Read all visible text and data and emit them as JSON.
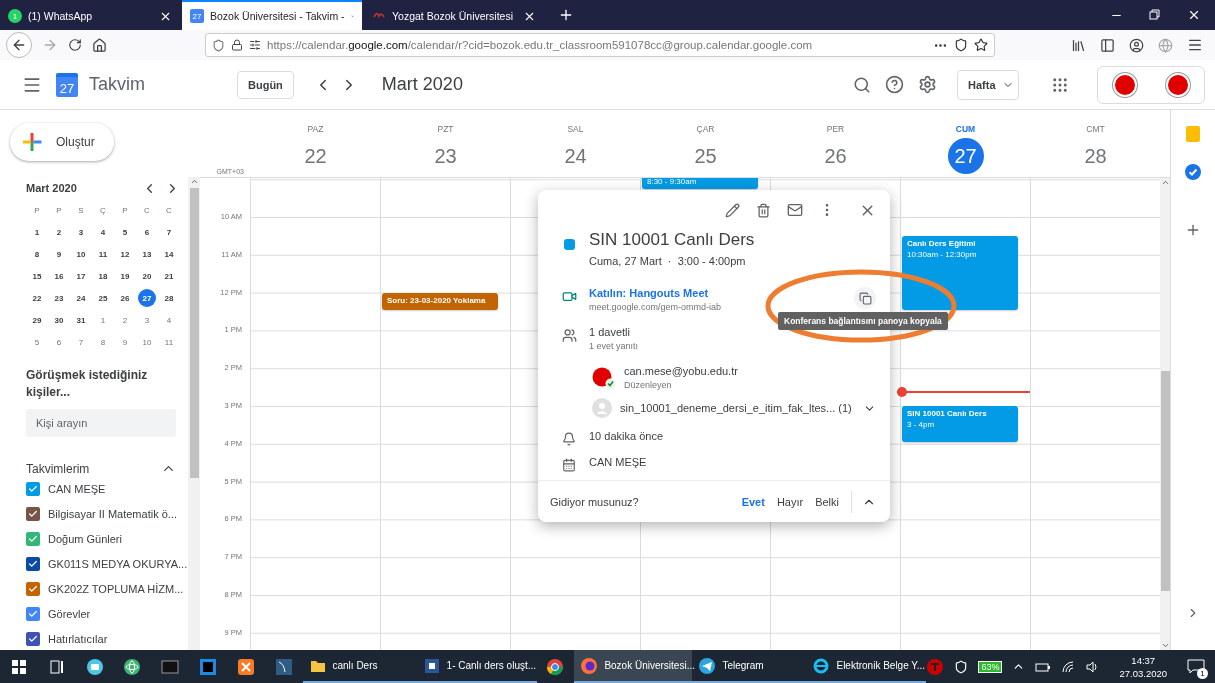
{
  "browser": {
    "tabs": [
      {
        "label": "(1) WhatsApp",
        "badge": "1",
        "selected": false
      },
      {
        "label": "Bozok Üniversitesi - Takvim -",
        "badge": "27",
        "selected": true
      },
      {
        "label": "Yozgat Bozok Üniversitesi",
        "selected": false
      }
    ],
    "url": "https://calendar.**google.com**/calendar/r?cid=bozok.edu.tr_classroom591078cc@group.calendar.google.com"
  },
  "header": {
    "logo_day": "27",
    "app_title": "Takvim",
    "today_button": "Bugün",
    "period": "Mart 2020",
    "view": "Hafta"
  },
  "sidebar": {
    "create_button": "Oluştur",
    "mini_calendar": {
      "title": "Mart 2020",
      "weekdays": [
        "P",
        "P",
        "S",
        "Ç",
        "P",
        "C",
        "C"
      ],
      "weeks": [
        [
          {
            "d": "1",
            "out": false,
            "selected": false
          },
          {
            "d": "2",
            "out": false,
            "selected": false
          },
          {
            "d": "3",
            "out": false,
            "selected": false
          },
          {
            "d": "4",
            "out": false,
            "selected": false
          },
          {
            "d": "5",
            "out": false,
            "selected": false
          },
          {
            "d": "6",
            "out": false,
            "selected": false
          },
          {
            "d": "7",
            "out": false,
            "selected": false
          }
        ],
        [
          {
            "d": "8",
            "out": false,
            "selected": false
          },
          {
            "d": "9",
            "out": false,
            "selected": false
          },
          {
            "d": "10",
            "out": false,
            "selected": false
          },
          {
            "d": "11",
            "out": false,
            "selected": false
          },
          {
            "d": "12",
            "out": false,
            "selected": false
          },
          {
            "d": "13",
            "out": false,
            "selected": false
          },
          {
            "d": "14",
            "out": false,
            "selected": false
          }
        ],
        [
          {
            "d": "15",
            "out": false,
            "selected": false
          },
          {
            "d": "16",
            "out": false,
            "selected": false
          },
          {
            "d": "17",
            "out": false,
            "selected": false
          },
          {
            "d": "18",
            "out": false,
            "selected": false
          },
          {
            "d": "19",
            "out": false,
            "selected": false
          },
          {
            "d": "20",
            "out": false,
            "selected": false
          },
          {
            "d": "21",
            "out": false,
            "selected": false
          }
        ],
        [
          {
            "d": "22",
            "out": false,
            "selected": false
          },
          {
            "d": "23",
            "out": false,
            "selected": false
          },
          {
            "d": "24",
            "out": false,
            "selected": false
          },
          {
            "d": "25",
            "out": false,
            "selected": false
          },
          {
            "d": "26",
            "out": false,
            "selected": false
          },
          {
            "d": "27",
            "out": false,
            "selected": true
          },
          {
            "d": "28",
            "out": false,
            "selected": false
          }
        ],
        [
          {
            "d": "29",
            "out": false,
            "selected": false
          },
          {
            "d": "30",
            "out": false,
            "selected": false
          },
          {
            "d": "31",
            "out": false,
            "selected": false
          },
          {
            "d": "1",
            "out": true,
            "selected": false
          },
          {
            "d": "2",
            "out": true,
            "selected": false
          },
          {
            "d": "3",
            "out": true,
            "selected": false
          },
          {
            "d": "4",
            "out": true,
            "selected": false
          }
        ],
        [
          {
            "d": "5",
            "out": true,
            "selected": false
          },
          {
            "d": "6",
            "out": true,
            "selected": false
          },
          {
            "d": "7",
            "out": true,
            "selected": false
          },
          {
            "d": "8",
            "out": true,
            "selected": false
          },
          {
            "d": "9",
            "out": true,
            "selected": false
          },
          {
            "d": "10",
            "out": true,
            "selected": false
          },
          {
            "d": "11",
            "out": true,
            "selected": false
          }
        ]
      ]
    },
    "people_title": "Görüşmek istediğiniz kişiler...",
    "people_search": {
      "placeholder": "Kişi arayın"
    },
    "calendars_title": "Takvimlerim",
    "calendars": [
      {
        "label": "CAN MEŞE",
        "color": "#039be5",
        "checked": true
      },
      {
        "label": "Bilgisayar II Matematik ö...",
        "color": "#795548",
        "checked": true
      },
      {
        "label": "Doğum Günleri",
        "color": "#33b679",
        "checked": true
      },
      {
        "label": "GK011S MEDYA OKURYA...",
        "color": "#0b4aa8",
        "checked": true
      },
      {
        "label": "GK202Z TOPLUMA HİZM...",
        "color": "#c26401",
        "checked": true
      },
      {
        "label": "Görevler",
        "color": "#4285f4",
        "checked": true
      },
      {
        "label": "Hatırlatıcılar",
        "color": "#3f51b5",
        "checked": true
      }
    ]
  },
  "week": {
    "timezone": "GMT+03",
    "days": [
      {
        "dow": "PAZ",
        "date": "22",
        "today": false,
        "now_line": false
      },
      {
        "dow": "PZT",
        "date": "23",
        "today": false,
        "now_line": false,
        "events": [
          {
            "title": "Soru: 23-03-2020 Yoklama",
            "color": "#c26401"
          }
        ]
      },
      {
        "dow": "SAL",
        "date": "24",
        "today": false,
        "now_line": false
      },
      {
        "dow": "ÇAR",
        "date": "25",
        "today": false,
        "now_line": false,
        "events": [
          {
            "time": "8:30 - 9:30am",
            "color": "#039be5"
          }
        ]
      },
      {
        "dow": "PER",
        "date": "26",
        "today": false,
        "now_line": false
      },
      {
        "dow": "CUM",
        "date": "27",
        "today": true,
        "now_line": true,
        "events": [
          {
            "title": "Canlı Ders Eğitimi",
            "time": "10:30am - 12:30pm",
            "color": "#039be5"
          },
          {
            "title": "SIN 10001 Canlı Ders",
            "time": "3 - 4pm",
            "color": "#039be5"
          }
        ]
      },
      {
        "dow": "CMT",
        "date": "28",
        "today": false,
        "now_line": false
      }
    ],
    "hours": [
      "10 AM",
      "11 AM",
      "12 PM",
      "1 PM",
      "2 PM",
      "3 PM",
      "4 PM",
      "5 PM",
      "6 PM",
      "7 PM",
      "8 PM",
      "9 PM"
    ]
  },
  "popup": {
    "color": "#039be5",
    "title": "SIN 10001 Canlı Ders",
    "when": "Cuma, 27 Mart  ·  3:00 - 4:00pm",
    "meet_link": "Katılın: Hangouts Meet",
    "meet_url": "meet.google.com/gem-ommd-iab",
    "copy_tooltip": "Konferans bağlantısını panoya kopyala",
    "guests_count": "1 davetli",
    "guests_summary": "1 evet yanıtı",
    "guests": [
      {
        "kind": "organizer",
        "name": "can.mese@yobu.edu.tr",
        "role": "Düzenleyen"
      },
      {
        "kind": "group",
        "name": "sin_10001_deneme_dersi_e_itim_fak_ltes... (1)"
      }
    ],
    "reminder": "10 dakika önce",
    "calendar": "CAN MEŞE",
    "rsvp_question": "Gidiyor musunuz?",
    "rsvp": [
      {
        "label": "Evet",
        "selected": true
      },
      {
        "label": "Hayır",
        "selected": false
      },
      {
        "label": "Belki",
        "selected": false
      }
    ]
  },
  "taskbar": {
    "apps": [
      {
        "label": "canlı Ders",
        "selected": false
      },
      {
        "label": "1- Canlı ders oluşt...",
        "selected": false
      },
      {
        "label": "Bozok Üniversitesi...",
        "selected": true
      },
      {
        "label": "Telegram",
        "selected": false
      },
      {
        "label": "Elektronik Belge Y...",
        "selected": false
      }
    ],
    "battery": "63%",
    "time": "14:37",
    "date": "27.03.2020",
    "notifications": "1"
  }
}
